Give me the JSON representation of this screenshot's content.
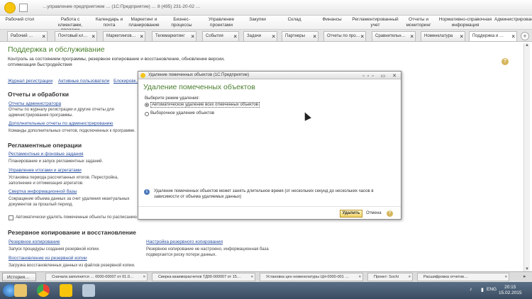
{
  "window": {
    "title": "…управление предприятием … (1С:Предприятие) … 8 (495) 231-20-02 …"
  },
  "sections": [
    "Рабочий стол",
    "Работа с клиентами, продажи",
    "Календарь и почта",
    "Маркетинг и планирование",
    "Бизнес-процессы",
    "Управление проектами",
    "Закупки",
    "Склад",
    "Финансы",
    "Регламентированный учет",
    "Отчеты и мониторинг",
    "Нормативно-справочная информация",
    "Администрирование"
  ],
  "tabs": [
    "Рабочий …",
    "Почтовый кл…",
    "Маркетингов…",
    "Телемаркетинг",
    "События",
    "Задачи",
    "Партнеры",
    "Отчеты по про…",
    "Сравнительн…",
    "Номенклатура",
    "Поддержка и …"
  ],
  "page": {
    "title": "Поддержка и обслуживание",
    "description": "Контроль за состоянием программы, резервное копирование и восстановление, обновление версии, оптимизация быстродействия",
    "top_links": [
      "Журнал регистрации",
      "Активные пользователи",
      "Блокировк…"
    ],
    "reports": {
      "heading": "Отчеты и обработки",
      "link1": "Отчеты администратора",
      "text1": "Отчеты по журналу регистрации и другие отчеты для администрирования программы.",
      "link2": "Дополнительные отчеты по администрированию",
      "text2": "Команды дополнительных отчетов, подключенных к программе."
    },
    "reglament": {
      "heading": "Регламентные операции",
      "link1": "Регламентные и фоновые задания",
      "text1": "Планирование и запуск регламентных заданий.",
      "link2": "Управление итогами и агрегатами",
      "text2": "Установка периода рассчитанных итогов. Перестройка, заполнение и оптимизация агрегатов.",
      "link3": "Свертка информационной базы",
      "text3": "Сокращение объема данных за счет удаления неактуальных документов за прошлый период.",
      "auto_delete": "Автоматически удалять помеченные объекты по расписанию"
    },
    "backup": {
      "heading": "Резервное копирование и восстановление",
      "link1": "Резервное копирование",
      "text1": "Запуск процедуры создания резервной копии.",
      "link2": "Восстановление из резервной копии",
      "text2": "Загрузка восстановленных данных из файлов резервной копии.",
      "link3": "Настройка резервного копирования",
      "text3": "Резервное копирование не настроено, информационная база подвергается риску потери данных."
    }
  },
  "dialog": {
    "title": "Удаление помеченных объектов (1С:Предприятие)",
    "heading": "Удаление помеченных объектов",
    "mode_label": "Выберите режим удаления:",
    "option_auto": "Автоматическое удаление всех отмеченных объектов",
    "option_selective": "Выборочное удаление объектов",
    "selected": "auto",
    "info": "Удаление помеченных объектов может занять длительное время (от нескольких секунд до нескольких часов в зависимости от объема удаляемых данных)",
    "delete_button": "Удалить",
    "cancel": "Отмена"
  },
  "status": {
    "history": "История…",
    "notifications": [
      "Сначала заполнится … 0000-00007 от 01.0…",
      "Сверка взаиморасчетов ТД00-000007 от 15…",
      "Установка цен номенклатуры ЦН-0000-001 …",
      "Проект: Sochi",
      "Расшифровка отчетов…"
    ]
  },
  "taskbar": {
    "lang": "ENG",
    "time": "20:15",
    "date": "15.02.2015"
  },
  "colors": {
    "title_green": "#4b7f2e",
    "link_blue": "#2a4fa0",
    "primary_button": "#f1d265"
  }
}
